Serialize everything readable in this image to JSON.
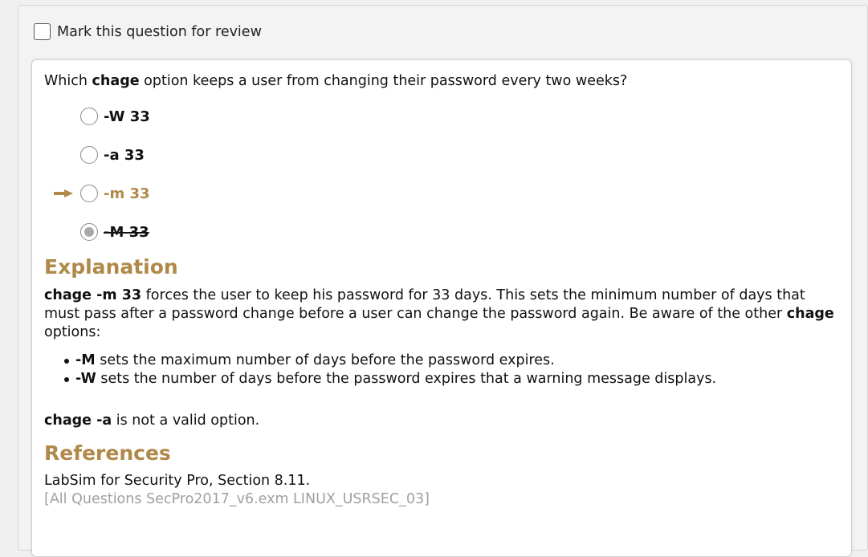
{
  "review": {
    "label": "Mark this question for review"
  },
  "question": {
    "prefix": "Which ",
    "command": "chage",
    "suffix": " option keeps a user from changing their password every two weeks?"
  },
  "options": [
    {
      "label": "-W 33",
      "state": "normal"
    },
    {
      "label": "-a 33",
      "state": "normal"
    },
    {
      "label": "-m 33",
      "state": "correct"
    },
    {
      "label": "-M 33",
      "state": "selected-wrong"
    }
  ],
  "explanation": {
    "heading": "Explanation",
    "p1_bold": "chage -m 33",
    "p1_text": " forces the user to keep his password for 33 days. This sets the minimum number of days that must pass after a password change before a user can change the password again. Be aware of the other ",
    "p1_bold2": "chage",
    "p1_end": " options:",
    "bullets": [
      {
        "flag": "-M",
        "text": " sets the maximum number of days before the password expires."
      },
      {
        "flag": "-W",
        "text": " sets the number of days before the password expires that a warning message displays."
      }
    ],
    "p2_bold": "chage -a",
    "p2_text": " is not a valid option."
  },
  "references": {
    "heading": "References",
    "source": "LabSim for Security Pro, Section 8.11.",
    "question_id": "[All Questions SecPro2017_v6.exm LINUX_USRSEC_03]"
  },
  "colors": {
    "accent": "#b0894a",
    "muted": "#a0a0a0"
  }
}
